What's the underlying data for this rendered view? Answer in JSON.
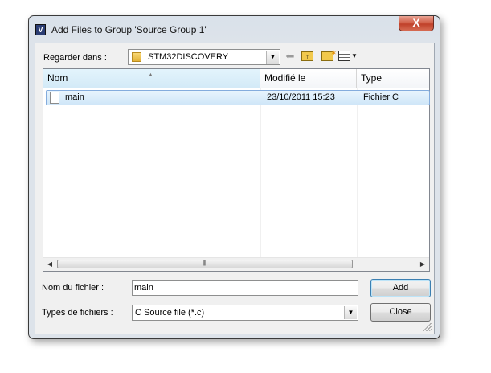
{
  "window": {
    "title": "Add Files to Group 'Source Group 1'",
    "close_glyph": "X",
    "app_icon_glyph": "V"
  },
  "lookin": {
    "label": "Regarder dans :",
    "value": "STM32DISCOVERY"
  },
  "toolbar": {
    "icons": [
      "back-icon",
      "up-folder-icon",
      "new-folder-icon",
      "views-menu-icon"
    ]
  },
  "filelist": {
    "columns": [
      {
        "label": "Nom"
      },
      {
        "label": "Modifié le"
      },
      {
        "label": "Type"
      }
    ],
    "rows": [
      {
        "name": "main",
        "modified": "23/10/2011 15:23",
        "type": "Fichier C",
        "selected": true
      }
    ]
  },
  "filename": {
    "label": "Nom du fichier :",
    "value": "main"
  },
  "filetype": {
    "label": "Types de fichiers :",
    "value": "C Source file (*.c)"
  },
  "buttons": {
    "add": "Add",
    "close": "Close"
  },
  "colors": {
    "selection": "#cfe6f8",
    "selection_border": "#84acdd",
    "close_button": "#c0412a",
    "window_frame": "#dde3ea"
  }
}
